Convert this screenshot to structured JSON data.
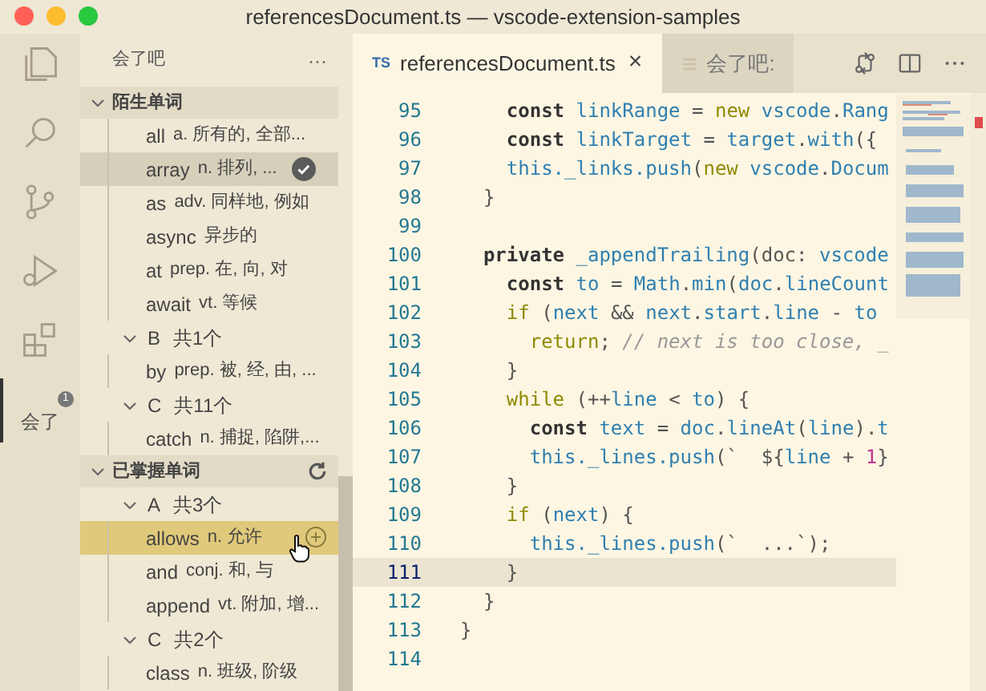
{
  "window": {
    "title": "referencesDocument.ts — vscode-extension-samples"
  },
  "activity_bar": {
    "items": [
      {
        "kind": "files",
        "selected": false
      },
      {
        "kind": "search",
        "selected": false
      },
      {
        "kind": "git",
        "selected": false
      },
      {
        "kind": "debug",
        "selected": false
      },
      {
        "kind": "extensions",
        "selected": false
      },
      {
        "kind": "text",
        "label": "会了",
        "badge": "1",
        "selected": true
      }
    ]
  },
  "sidebar": {
    "title": "会了吧",
    "more": "···",
    "sections": [
      {
        "label": "陌生单词",
        "expanded": true,
        "groups": [
          {
            "children": [
              {
                "word": "all",
                "meaning": "a. 所有的, 全部...",
                "selected": false,
                "hovered": false
              },
              {
                "word": "array",
                "meaning": "n. 排列, ...",
                "selected": true,
                "hovered": false
              },
              {
                "word": "as",
                "meaning": "adv. 同样地, 例如",
                "selected": false,
                "hovered": false
              },
              {
                "word": "async",
                "meaning": "异步的",
                "selected": false,
                "hovered": false
              },
              {
                "word": "at",
                "meaning": "prep. 在, 向, 对",
                "selected": false,
                "hovered": false
              },
              {
                "word": "await",
                "meaning": "vt. 等候",
                "selected": false,
                "hovered": false
              }
            ]
          },
          {
            "letter": "B",
            "count": "共1个",
            "expanded": true,
            "children": [
              {
                "word": "by",
                "meaning": "prep. 被, 经, 由, ...",
                "selected": false,
                "hovered": false
              }
            ]
          },
          {
            "letter": "C",
            "count": "共11个",
            "expanded": true,
            "children": [
              {
                "word": "catch",
                "meaning": "n. 捕捉, 陷阱,...",
                "selected": false,
                "hovered": false
              }
            ]
          }
        ]
      },
      {
        "label": "已掌握单词",
        "expanded": true,
        "refresh": true,
        "groups": [
          {
            "letter": "A",
            "count": "共3个",
            "expanded": true,
            "children": [
              {
                "word": "allows",
                "meaning": "n. 允许",
                "selected": false,
                "hovered": true
              },
              {
                "word": "and",
                "meaning": "conj. 和, 与",
                "selected": false,
                "hovered": false
              },
              {
                "word": "append",
                "meaning": "vt. 附加, 增...",
                "selected": false,
                "hovered": false
              }
            ]
          },
          {
            "letter": "C",
            "count": "共2个",
            "expanded": true,
            "children": [
              {
                "word": "class",
                "meaning": "n. 班级, 阶级",
                "selected": false,
                "hovered": false
              }
            ]
          }
        ]
      }
    ]
  },
  "tabs": [
    {
      "badge": "TS",
      "label": "referencesDocument.ts",
      "close": "×",
      "selected": true
    },
    {
      "label": "会了吧:",
      "selected": false
    }
  ],
  "editor": {
    "lines": [
      {
        "number": "95",
        "current": false,
        "tokens": [
          {
            "kind": "k",
            "text": "    const"
          },
          {
            "kind": "n",
            "text": " linkRange"
          },
          {
            "kind": "p",
            "text": " = "
          },
          {
            "kind": "c",
            "text": "new"
          },
          {
            "kind": "n",
            "text": " vscode"
          },
          {
            "kind": "p",
            "text": "."
          },
          {
            "kind": "n",
            "text": "Rang"
          }
        ]
      },
      {
        "number": "96",
        "current": false,
        "tokens": [
          {
            "kind": "k",
            "text": "    const"
          },
          {
            "kind": "n",
            "text": " linkTarget"
          },
          {
            "kind": "p",
            "text": " = "
          },
          {
            "kind": "n",
            "text": "target"
          },
          {
            "kind": "p",
            "text": "."
          },
          {
            "kind": "n",
            "text": "with"
          },
          {
            "kind": "p",
            "text": "({"
          }
        ]
      },
      {
        "number": "97",
        "current": false,
        "tokens": [
          {
            "kind": "n",
            "text": "    this._links.push"
          },
          {
            "kind": "p",
            "text": "("
          },
          {
            "kind": "c",
            "text": "new"
          },
          {
            "kind": "n",
            "text": " vscode"
          },
          {
            "kind": "p",
            "text": "."
          },
          {
            "kind": "n",
            "text": "Docum"
          }
        ]
      },
      {
        "number": "98",
        "current": false,
        "tokens": [
          {
            "kind": "p",
            "text": "  }"
          }
        ]
      },
      {
        "number": "99",
        "current": false
      },
      {
        "number": "100",
        "current": false,
        "tokens": [
          {
            "kind": "k",
            "text": "  private"
          },
          {
            "kind": "n",
            "text": " _appendTrailing"
          },
          {
            "kind": "p",
            "text": "(doc: "
          },
          {
            "kind": "n",
            "text": "vscode"
          }
        ]
      },
      {
        "number": "101",
        "current": false,
        "tokens": [
          {
            "kind": "k",
            "text": "    const"
          },
          {
            "kind": "n",
            "text": " to"
          },
          {
            "kind": "p",
            "text": " = "
          },
          {
            "kind": "n",
            "text": "Math"
          },
          {
            "kind": "p",
            "text": "."
          },
          {
            "kind": "n",
            "text": "min"
          },
          {
            "kind": "p",
            "text": "("
          },
          {
            "kind": "n",
            "text": "doc"
          },
          {
            "kind": "p",
            "text": "."
          },
          {
            "kind": "n",
            "text": "lineCount"
          }
        ]
      },
      {
        "number": "102",
        "current": false,
        "tokens": [
          {
            "kind": "c",
            "text": "    if"
          },
          {
            "kind": "p",
            "text": " ("
          },
          {
            "kind": "n",
            "text": "next"
          },
          {
            "kind": "p",
            "text": " && "
          },
          {
            "kind": "n",
            "text": "next"
          },
          {
            "kind": "p",
            "text": "."
          },
          {
            "kind": "n",
            "text": "start"
          },
          {
            "kind": "p",
            "text": "."
          },
          {
            "kind": "n",
            "text": "line"
          },
          {
            "kind": "p",
            "text": " - "
          },
          {
            "kind": "n",
            "text": "to"
          }
        ]
      },
      {
        "number": "103",
        "current": false,
        "tokens": [
          {
            "kind": "c",
            "text": "      return"
          },
          {
            "kind": "p",
            "text": "; "
          },
          {
            "kind": "m",
            "text": "// next is too close, _"
          }
        ]
      },
      {
        "number": "104",
        "current": false,
        "tokens": [
          {
            "kind": "p",
            "text": "    }"
          }
        ]
      },
      {
        "number": "105",
        "current": false,
        "tokens": [
          {
            "kind": "c",
            "text": "    while"
          },
          {
            "kind": "p",
            "text": " (++"
          },
          {
            "kind": "n",
            "text": "line"
          },
          {
            "kind": "p",
            "text": " < "
          },
          {
            "kind": "n",
            "text": "to"
          },
          {
            "kind": "p",
            "text": ") {"
          }
        ]
      },
      {
        "number": "106",
        "current": false,
        "tokens": [
          {
            "kind": "k",
            "text": "      const"
          },
          {
            "kind": "n",
            "text": " text"
          },
          {
            "kind": "p",
            "text": " = "
          },
          {
            "kind": "n",
            "text": "doc"
          },
          {
            "kind": "p",
            "text": "."
          },
          {
            "kind": "n",
            "text": "lineAt"
          },
          {
            "kind": "p",
            "text": "("
          },
          {
            "kind": "n",
            "text": "line"
          },
          {
            "kind": "p",
            "text": ")."
          },
          {
            "kind": "n",
            "text": "t"
          }
        ]
      },
      {
        "number": "107",
        "current": false,
        "tokens": [
          {
            "kind": "n",
            "text": "      this._lines.push"
          },
          {
            "kind": "p",
            "text": "(`  ${"
          },
          {
            "kind": "n",
            "text": "line"
          },
          {
            "kind": "p",
            "text": " + "
          },
          {
            "kind": "d",
            "text": "1"
          },
          {
            "kind": "p",
            "text": "}"
          }
        ]
      },
      {
        "number": "108",
        "current": false,
        "tokens": [
          {
            "kind": "p",
            "text": "    }"
          }
        ]
      },
      {
        "number": "109",
        "current": false,
        "tokens": [
          {
            "kind": "c",
            "text": "    if"
          },
          {
            "kind": "p",
            "text": " ("
          },
          {
            "kind": "n",
            "text": "next"
          },
          {
            "kind": "p",
            "text": ") {"
          }
        ]
      },
      {
        "number": "110",
        "current": false,
        "tokens": [
          {
            "kind": "n",
            "text": "      this._lines.push"
          },
          {
            "kind": "p",
            "text": "(`  ...`);"
          }
        ]
      },
      {
        "number": "111",
        "current": true,
        "tokens": [
          {
            "kind": "p",
            "text": "    }"
          }
        ]
      },
      {
        "number": "112",
        "current": false,
        "tokens": [
          {
            "kind": "p",
            "text": "  }"
          }
        ]
      },
      {
        "number": "113",
        "current": false,
        "tokens": [
          {
            "kind": "p",
            "text": "}"
          }
        ]
      },
      {
        "number": "114",
        "current": false
      }
    ]
  }
}
